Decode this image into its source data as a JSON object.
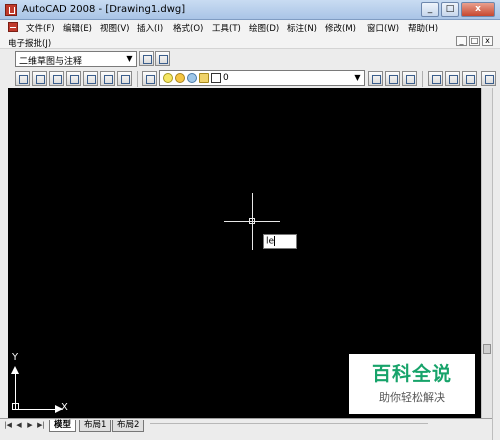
{
  "window": {
    "title": "AutoCAD 2008 - [Drawing1.dwg]",
    "controls": [
      "_",
      "□",
      "x"
    ]
  },
  "menu": {
    "items": [
      "文件(F)",
      "编辑(E)",
      "视图(V)",
      "插入(I)",
      "格式(O)",
      "工具(T)",
      "绘图(D)",
      "标注(N)",
      "修改(M)",
      "窗口(W)",
      "帮助(H)"
    ],
    "second_row": "电子报批(J)",
    "doc_controls": [
      "_",
      "□",
      "x"
    ]
  },
  "toolbar": {
    "workspace": "二维草图与注释",
    "layer_value": "0"
  },
  "drawing": {
    "command_input": "le",
    "background": "#000000",
    "crosshair_color": "#e8e8e8",
    "ucs_x": "X",
    "ucs_y": "Y"
  },
  "watermark": {
    "title": "百科全说",
    "subtitle": "助你轻松解决",
    "color": "#17a36a"
  },
  "tabs": {
    "items": [
      "模型",
      "布局1",
      "布局2"
    ],
    "active": "模型"
  }
}
